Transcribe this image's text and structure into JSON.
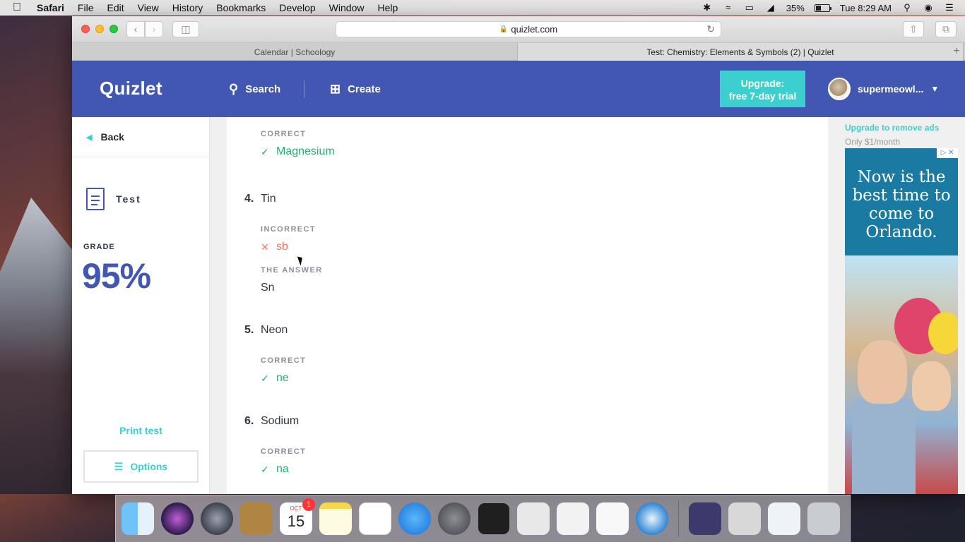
{
  "menubar": {
    "app": "Safari",
    "menus": [
      "File",
      "Edit",
      "View",
      "History",
      "Bookmarks",
      "Develop",
      "Window",
      "Help"
    ],
    "battery": "35%",
    "clock": "Tue 8:29 AM"
  },
  "browser": {
    "url": "quizlet.com",
    "tabs": [
      {
        "label": "Calendar | Schoology"
      },
      {
        "label": "Test: Chemistry: Elements & Symbols (2) | Quizlet"
      }
    ]
  },
  "header": {
    "logo": "Quizlet",
    "search_label": "Search",
    "create_label": "Create",
    "upgrade_line1": "Upgrade:",
    "upgrade_line2": "free 7-day trial",
    "username": "supermeowl..."
  },
  "sidebar": {
    "back_label": "Back",
    "mode_label": "Test",
    "grade_label": "GRADE",
    "grade_value": "95%",
    "print_label": "Print test",
    "options_label": "Options"
  },
  "questions": {
    "q3": {
      "status_label": "CORRECT",
      "answer": "Magnesium"
    },
    "q4": {
      "number": "4.",
      "term": "Tin",
      "status_label": "INCORRECT",
      "answer": "sb",
      "answer_label": "THE ANSWER",
      "correct_answer": "Sn"
    },
    "q5": {
      "number": "5.",
      "term": "Neon",
      "status_label": "CORRECT",
      "answer": "ne"
    },
    "q6": {
      "number": "6.",
      "term": "Sodium",
      "status_label": "CORRECT",
      "answer": "na"
    }
  },
  "ad": {
    "upgrade_link": "Upgrade to remove ads",
    "price": "Only $1/month",
    "headline": "Now is the best time to come to Orlando."
  },
  "dock": {
    "calendar_month": "OCT",
    "calendar_day": "15",
    "calendar_badge": "1"
  },
  "colors": {
    "quizlet_blue": "#4257b2",
    "teal": "#3ccfcf",
    "correct_green": "#23b26d",
    "incorrect_red": "#ff725b"
  }
}
